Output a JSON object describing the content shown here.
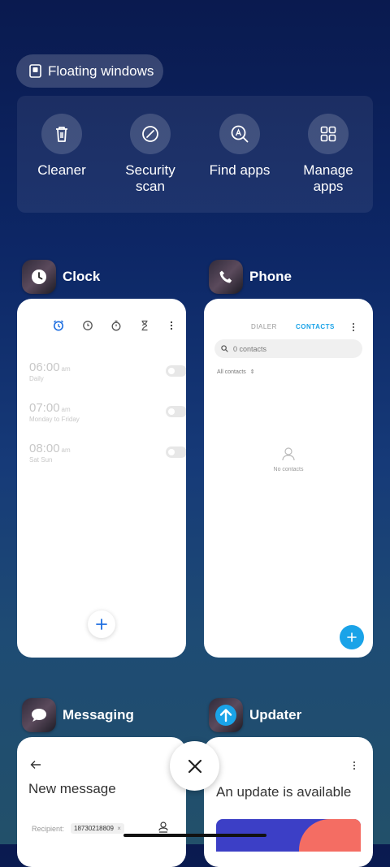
{
  "floating_windows": {
    "label": "Floating windows",
    "icon": "floating-window-icon"
  },
  "quick_actions": [
    {
      "label": "Cleaner",
      "icon": "trash-icon"
    },
    {
      "label": "Security\nscan",
      "icon": "security-scan-icon"
    },
    {
      "label": "Find apps",
      "icon": "find-apps-icon"
    },
    {
      "label": "Manage\napps",
      "icon": "grid-icon"
    }
  ],
  "apps": {
    "clock": {
      "name": "Clock",
      "alarms": [
        {
          "time": "06:00",
          "ampm": "am",
          "repeat": "Daily"
        },
        {
          "time": "07:00",
          "ampm": "am",
          "repeat": "Monday to Friday"
        },
        {
          "time": "08:00",
          "ampm": "am",
          "repeat": "Sat Sun"
        }
      ]
    },
    "phone": {
      "name": "Phone",
      "tabs": [
        "DIALER",
        "CONTACTS"
      ],
      "active_tab": "CONTACTS",
      "search_placeholder": "0 contacts",
      "filter": "All contacts",
      "empty_text": "No contacts"
    },
    "messaging": {
      "name": "Messaging",
      "title": "New message",
      "recipient_label": "Recipient:",
      "recipient_value": "18730218809"
    },
    "updater": {
      "name": "Updater",
      "title": "An update is available"
    }
  },
  "colors": {
    "accent_blue": "#1aa3e8",
    "clock_accent": "#1f6fe0",
    "banner_blue": "#3c3fc6",
    "banner_red": "#f46d63"
  }
}
